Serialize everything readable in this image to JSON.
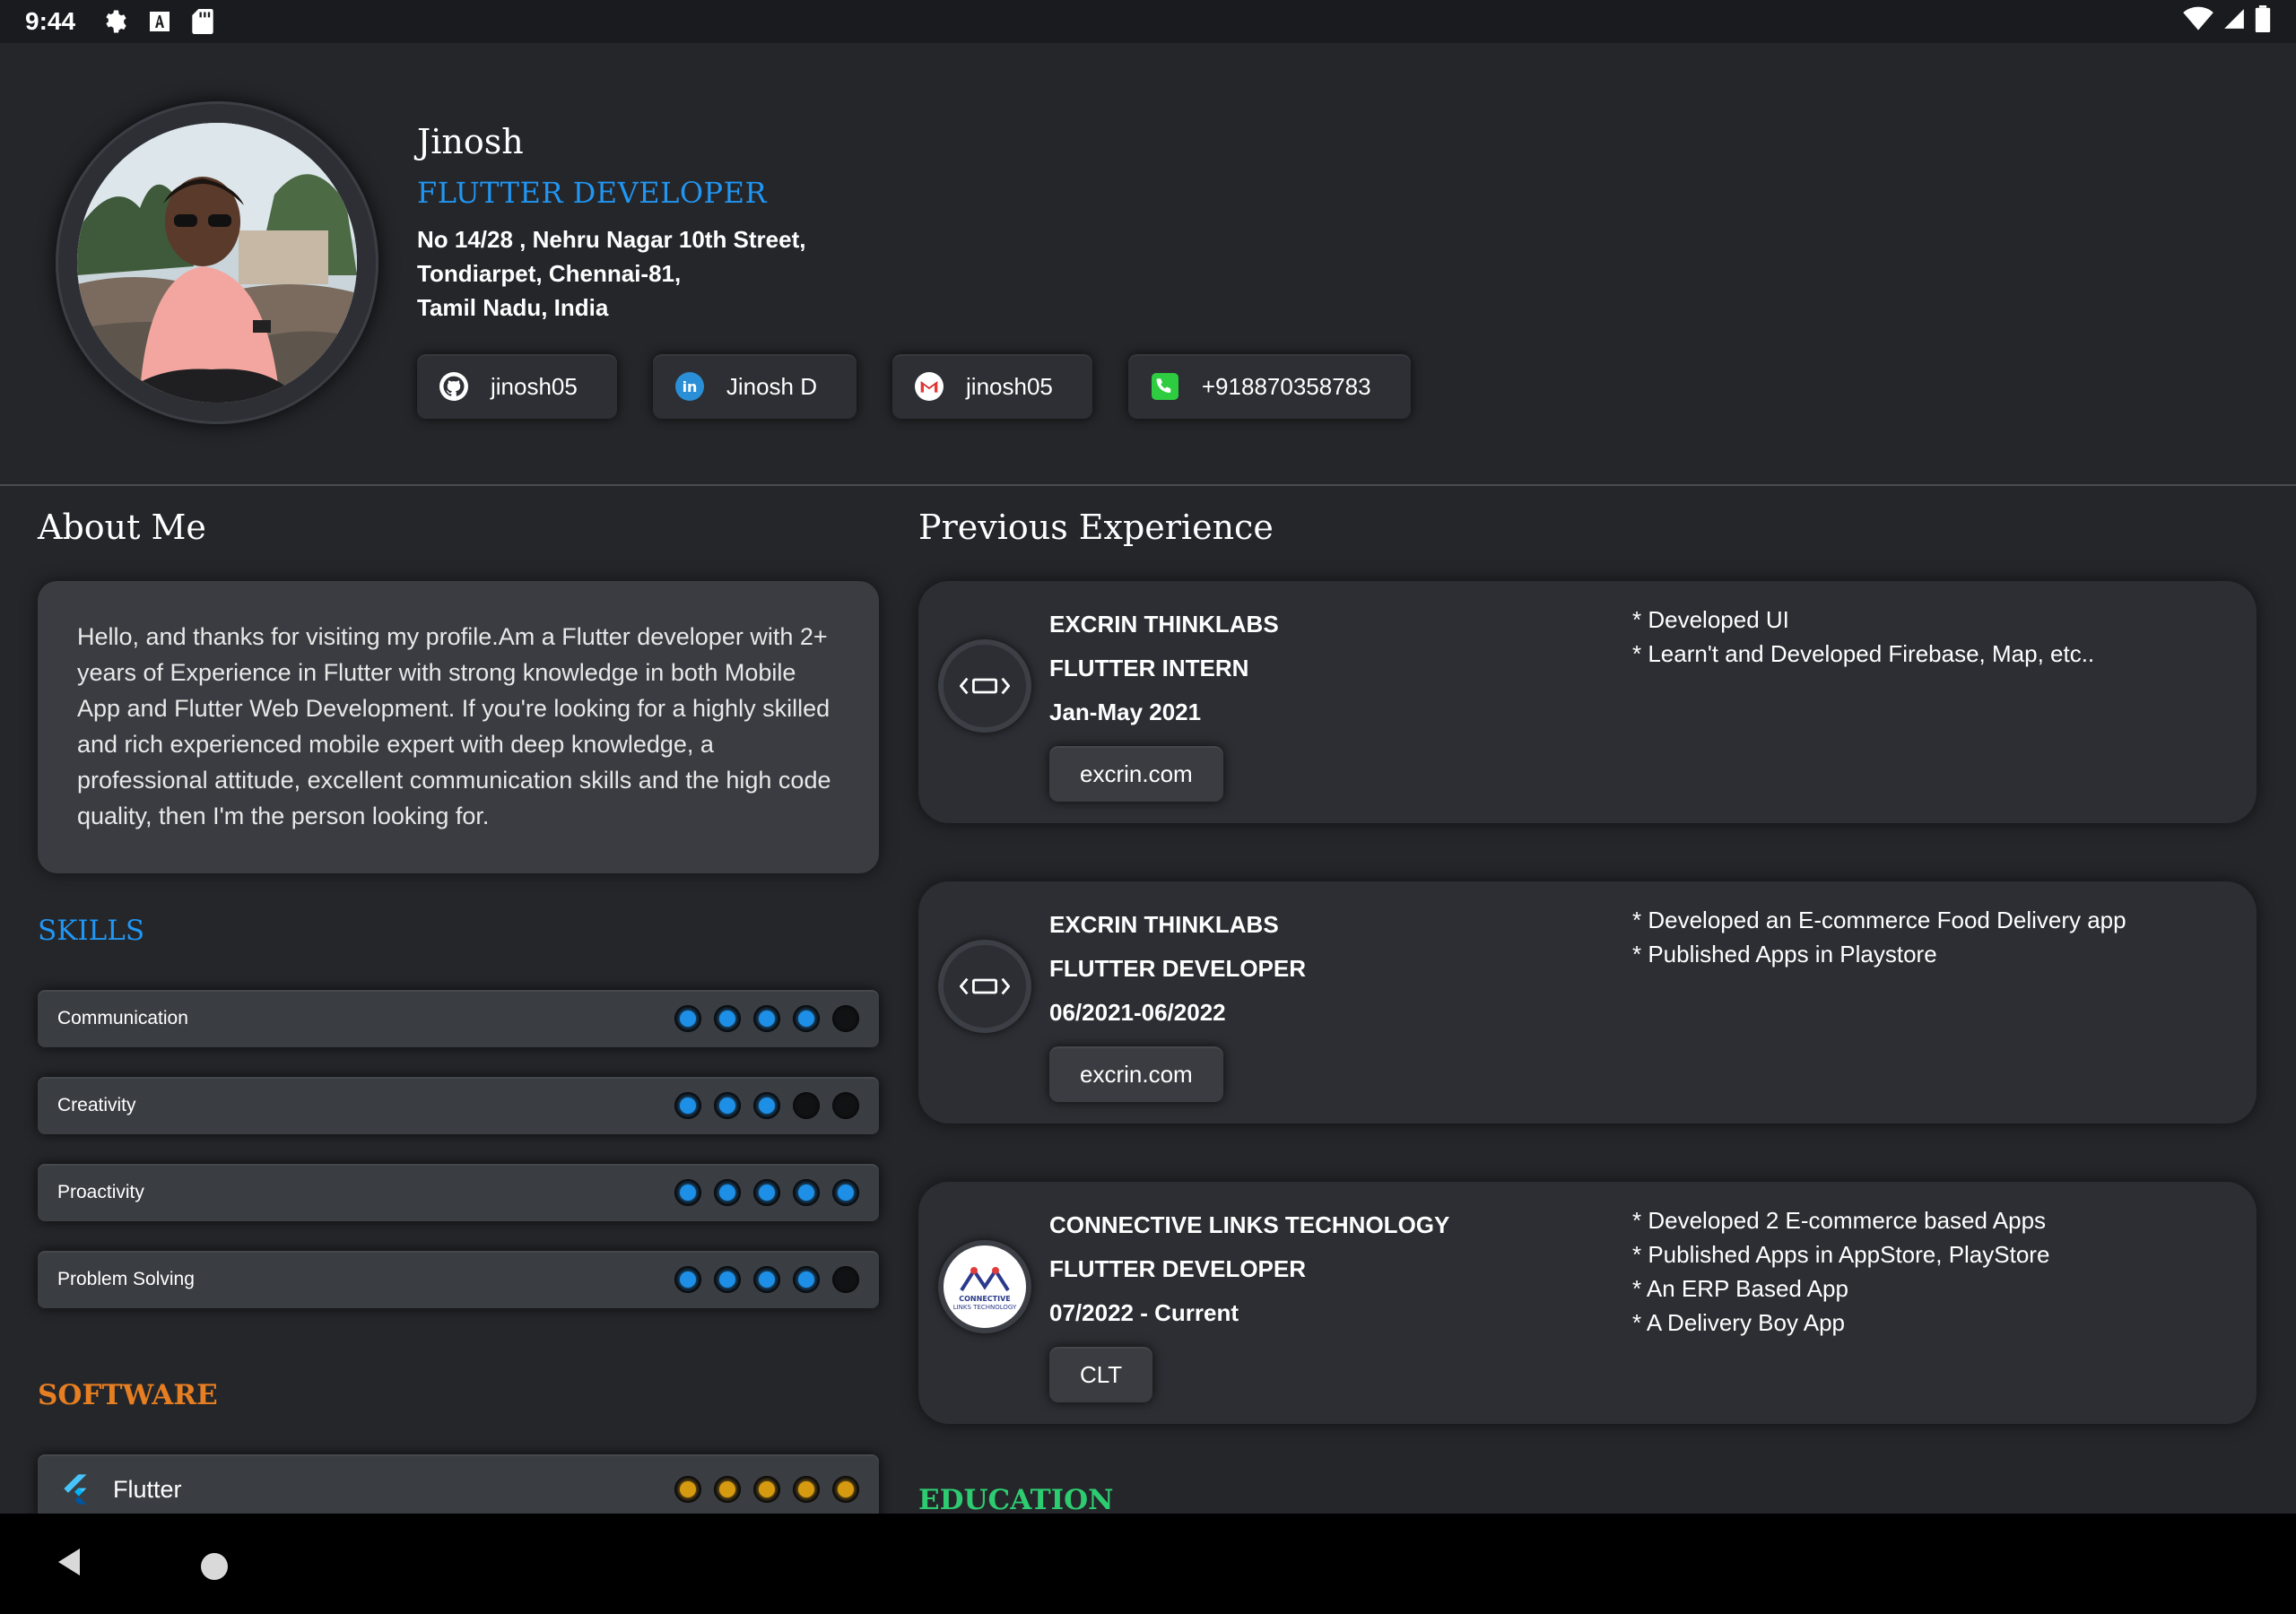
{
  "status_bar": {
    "time": "9:44",
    "icons_left": [
      "gear-icon",
      "font-a-icon",
      "sd-card-icon"
    ],
    "icons_right": [
      "wifi-icon",
      "signal-icon",
      "battery-icon"
    ]
  },
  "profile": {
    "name": "Jinosh",
    "role": "FLUTTER DEVELOPER",
    "address_line1": "No 14/28 , Nehru Nagar 10th Street,",
    "address_line2": "Tondiarpet, Chennai-81,",
    "address_line3": "Tamil Nadu, India"
  },
  "contacts": [
    {
      "icon": "github-icon",
      "label": "jinosh05"
    },
    {
      "icon": "linkedin-icon",
      "label": "Jinosh D"
    },
    {
      "icon": "gmail-icon",
      "label": "jinosh05"
    },
    {
      "icon": "phone-icon",
      "label": "+918870358783"
    }
  ],
  "about": {
    "title": "About Me",
    "text": "Hello, and thanks for visiting my profile.Am a Flutter developer with 2+ years of Experience in Flutter with strong knowledge in both Mobile App and Flutter Web Development. If you're looking for a highly skilled and rich experienced mobile expert with deep knowledge, a professional attitude, excellent communication skills and the high code quality, then I'm the person looking for."
  },
  "skills": {
    "title": "SKILLS",
    "items": [
      {
        "label": "Communication",
        "level": 4,
        "max": 5
      },
      {
        "label": "Creativity",
        "level": 3,
        "max": 5
      },
      {
        "label": "Proactivity",
        "level": 5,
        "max": 5
      },
      {
        "label": "Problem Solving",
        "level": 4,
        "max": 5
      }
    ]
  },
  "software": {
    "title": "SOFTWARE",
    "items": [
      {
        "label": "Flutter",
        "icon": "flutter-icon",
        "level": 5,
        "max": 5
      }
    ]
  },
  "experience": {
    "title": "Previous Experience",
    "items": [
      {
        "company": "EXCRIN THINKLABS",
        "role": "FLUTTER INTERN",
        "period": "Jan-May 2021",
        "link": "excrin.com",
        "logo": "code-icon",
        "notes": [
          "* Developed UI",
          "* Learn't and Developed Firebase, Map, etc.."
        ]
      },
      {
        "company": "EXCRIN THINKLABS",
        "role": "FLUTTER DEVELOPER",
        "period": "06/2021-06/2022",
        "link": "excrin.com",
        "logo": "code-icon",
        "notes": [
          "* Developed an E-commerce Food Delivery app",
          "* Published Apps in Playstore"
        ]
      },
      {
        "company": "CONNECTIVE LINKS TECHNOLOGY",
        "role": "FLUTTER DEVELOPER",
        "period": "07/2022 - Current",
        "link": "CLT",
        "logo": "connective-links-logo",
        "notes": [
          "* Developed 2 E-commerce based Apps",
          "* Published Apps in AppStore, PlayStore",
          "* An ERP Based App",
          "* A Delivery Boy App"
        ]
      }
    ]
  },
  "education": {
    "title": "EDUCATION"
  },
  "nav_bar": {
    "icons": [
      "back-icon",
      "home-icon"
    ]
  },
  "colors": {
    "accent_blue": "#2196f3",
    "software_orange": "#e67e22",
    "education_green": "#2ecc71",
    "background": "#24262a"
  }
}
